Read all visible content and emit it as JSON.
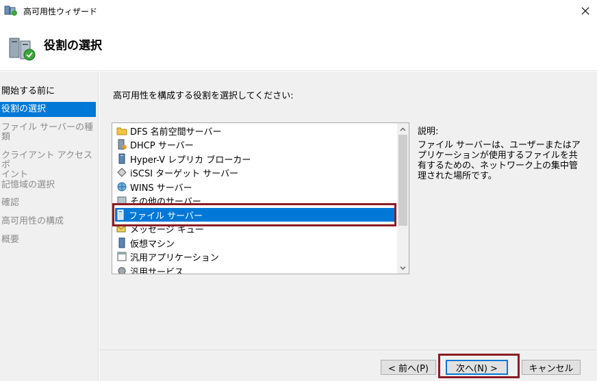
{
  "window": {
    "title": "高可用性ウィザード",
    "close_icon": "close-icon"
  },
  "header": {
    "title": "役割の選択",
    "icon": "cluster-server-icon"
  },
  "nav": {
    "items": [
      {
        "label": "開始する前に",
        "state": "done"
      },
      {
        "label": "役割の選択",
        "state": "active"
      },
      {
        "label": "ファイル サーバーの種\n類",
        "state": "disabled"
      },
      {
        "label": "クライアント アクセス ポ\nイント",
        "state": "disabled"
      },
      {
        "label": "記憶域の選択",
        "state": "disabled"
      },
      {
        "label": "確認",
        "state": "disabled"
      },
      {
        "label": "高可用性の構成",
        "state": "disabled"
      },
      {
        "label": "概要",
        "state": "disabled"
      }
    ]
  },
  "main": {
    "instruction": "高可用性を構成する役割を選択してください:",
    "roles": [
      {
        "label": "DFS 名前空間サーバー",
        "icon": "folder-tree-icon"
      },
      {
        "label": "DHCP サーバー",
        "icon": "dhcp-server-icon"
      },
      {
        "label": "Hyper-V レプリカ ブローカー",
        "icon": "server-tower-icon"
      },
      {
        "label": "iSCSI ターゲット サーバー",
        "icon": "iscsi-icon"
      },
      {
        "label": "WINS サーバー",
        "icon": "wins-globe-icon"
      },
      {
        "label": "その他のサーバー",
        "icon": "server-generic-icon"
      },
      {
        "label": "ファイル サーバー",
        "icon": "file-server-icon",
        "selected": true
      },
      {
        "label": "メッセージ キュー",
        "icon": "message-queue-icon"
      },
      {
        "label": "仮想マシン",
        "icon": "virtual-machine-icon"
      },
      {
        "label": "汎用アプリケーション",
        "icon": "generic-app-icon"
      },
      {
        "label": "汎用サービス",
        "icon": "generic-service-icon"
      }
    ],
    "description_label": "説明:",
    "description": "ファイル サーバーは、ユーザーまたはアプリケーションが使用するファイルを共有するための、ネットワーク上の集中管理された場所です。"
  },
  "footer": {
    "back_label": "< 前へ(P)",
    "next_label": "次へ(N) >",
    "cancel_label": "キャンセル"
  },
  "colors": {
    "accent": "#0078d7",
    "highlight_box": "#8b1a24"
  }
}
